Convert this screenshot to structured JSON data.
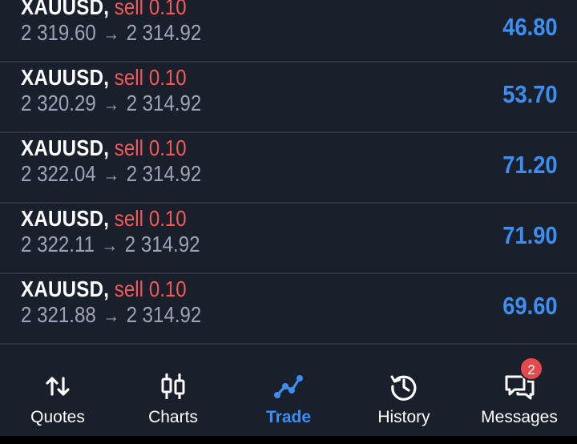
{
  "positions": [
    {
      "symbol": "XAUUSD",
      "comma": ",",
      "side": "sell",
      "volume": "0.10",
      "open_price": "2 319.60",
      "arrow": "→",
      "current_price": "2 314.92",
      "profit": "46.80"
    },
    {
      "symbol": "XAUUSD",
      "comma": ",",
      "side": "sell",
      "volume": "0.10",
      "open_price": "2 320.29",
      "arrow": "→",
      "current_price": "2 314.92",
      "profit": "53.70"
    },
    {
      "symbol": "XAUUSD",
      "comma": ",",
      "side": "sell",
      "volume": "0.10",
      "open_price": "2 322.04",
      "arrow": "→",
      "current_price": "2 314.92",
      "profit": "71.20"
    },
    {
      "symbol": "XAUUSD",
      "comma": ",",
      "side": "sell",
      "volume": "0.10",
      "open_price": "2 322.11",
      "arrow": "→",
      "current_price": "2 314.92",
      "profit": "71.90"
    },
    {
      "symbol": "XAUUSD",
      "comma": ",",
      "side": "sell",
      "volume": "0.10",
      "open_price": "2 321.88",
      "arrow": "→",
      "current_price": "2 314.92",
      "profit": "69.60"
    }
  ],
  "tabbar": {
    "tabs": [
      {
        "label": "Quotes",
        "icon": "quotes-arrows-icon",
        "active": false
      },
      {
        "label": "Charts",
        "icon": "candlestick-icon",
        "active": false
      },
      {
        "label": "Trade",
        "icon": "trade-line-icon",
        "active": true
      },
      {
        "label": "History",
        "icon": "history-clock-icon",
        "active": false
      },
      {
        "label": "Messages",
        "icon": "messages-icon",
        "active": false
      }
    ],
    "messages_badge": "2"
  },
  "colors": {
    "background": "#1a202b",
    "sell": "#ef5a5a",
    "profit": "#3d8ef2",
    "active_tab": "#3d8ef2",
    "price_text": "#9aa4b6",
    "badge": "#e5484d"
  }
}
